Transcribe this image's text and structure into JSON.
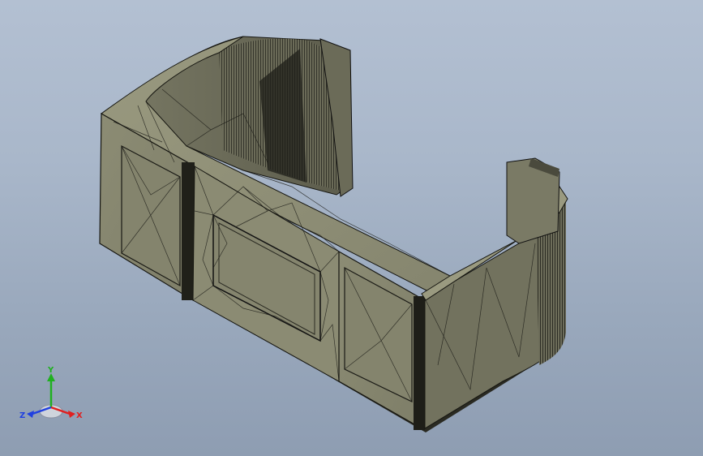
{
  "viewport": {
    "background_top": "#b3c0d2",
    "background_bottom": "#8e9db2"
  },
  "model": {
    "face_color": "#8a8a72",
    "face_dark": "#2e2e26",
    "face_mid": "#6f6f5d",
    "edge_color": "#111111",
    "render_mode": "shaded-with-edges"
  },
  "triad": {
    "x_label": "X",
    "y_label": "Y",
    "z_label": "Z",
    "x_color": "#e02020",
    "y_color": "#20b020",
    "z_color": "#2040e0"
  }
}
